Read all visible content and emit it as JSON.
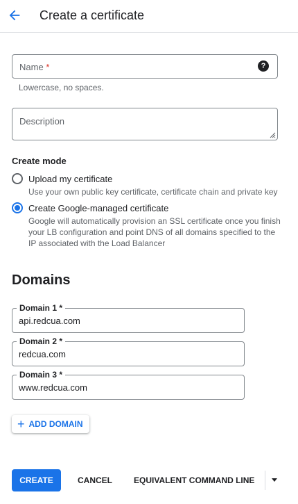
{
  "header": {
    "title": "Create a certificate"
  },
  "form": {
    "name": {
      "label": "Name",
      "required_mark": "*",
      "help_icon": "?",
      "hint": "Lowercase, no spaces."
    },
    "description": {
      "label": "Description"
    },
    "create_mode": {
      "label": "Create mode",
      "options": [
        {
          "label": "Upload my certificate",
          "desc": "Use your own public key certificate, certificate chain and private key",
          "checked": false
        },
        {
          "label": "Create Google-managed certificate",
          "desc": "Google will automatically provision an SSL certificate once you finish your LB configuration and point DNS of all domains specified to the IP associated with the Load Balancer",
          "checked": true
        }
      ]
    }
  },
  "domains": {
    "title": "Domains",
    "items": [
      {
        "label": "Domain 1 *",
        "value": "api.redcua.com"
      },
      {
        "label": "Domain 2 *",
        "value": "redcua.com"
      },
      {
        "label": "Domain 3 *",
        "value": "www.redcua.com"
      }
    ],
    "add_label": "ADD DOMAIN",
    "add_icon": "+"
  },
  "actions": {
    "create": "CREATE",
    "cancel": "CANCEL",
    "command_line": "EQUIVALENT COMMAND LINE"
  },
  "colors": {
    "accent": "#1a73e8",
    "required": "#d93025"
  }
}
